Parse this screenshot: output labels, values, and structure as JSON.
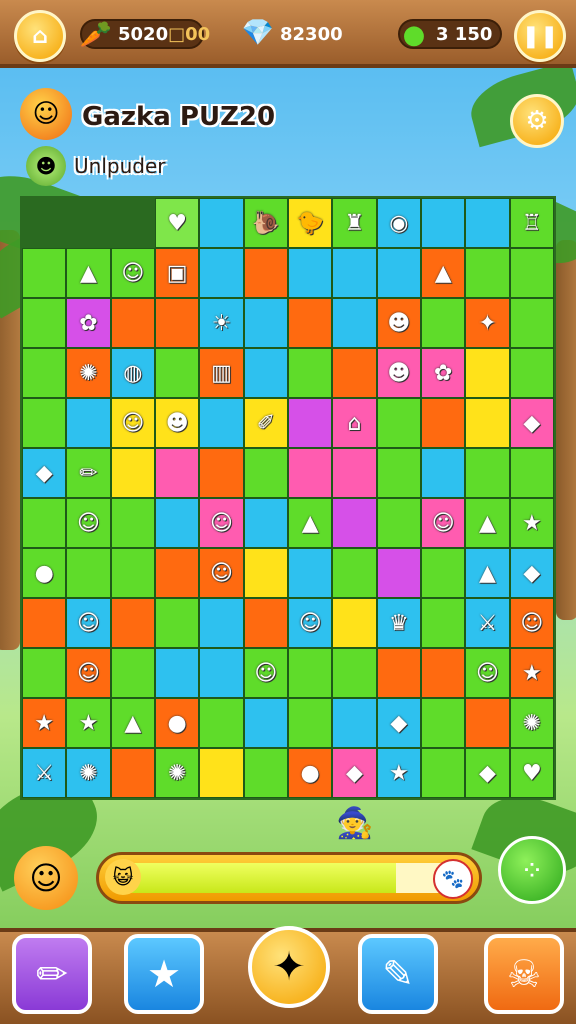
{
  "top_bar": {
    "home_icon": "house-icon",
    "coins_value": "5020",
    "coins_suffix": "□00",
    "coins_icon": "carrot-icon",
    "gems_value": "82300",
    "gems_icon": "crystal-icon",
    "lives_value": "3 150",
    "lives_icon": "green-orb-icon",
    "pause_icon": "pause-icon"
  },
  "header": {
    "title": "Gazka PUZ20",
    "subtitle": "Unlpuder",
    "title_icon": "sun-mascot-icon",
    "settings_icon": "gear-icon"
  },
  "grid": {
    "rows": [
      [
        "",
        "",
        "",
        "lg",
        "b",
        "g",
        "y",
        "g",
        "b",
        "b",
        "b",
        "g"
      ],
      [
        "g",
        "g",
        "g",
        "o",
        "b",
        "o",
        "b",
        "b",
        "b",
        "o",
        "g",
        "g"
      ],
      [
        "g",
        "p",
        "o",
        "o",
        "b",
        "b",
        "o",
        "b",
        "o",
        "g",
        "o",
        "g"
      ],
      [
        "g",
        "o",
        "b",
        "g",
        "o",
        "b",
        "g",
        "o",
        "pk",
        "pk",
        "y",
        "g"
      ],
      [
        "g",
        "b",
        "y",
        "y",
        "b",
        "y",
        "p",
        "pk",
        "g",
        "o",
        "y",
        "pk"
      ],
      [
        "b",
        "g",
        "y",
        "pk",
        "o",
        "g",
        "pk",
        "pk",
        "g",
        "b",
        "g",
        "g"
      ],
      [
        "g",
        "g",
        "g",
        "b",
        "pk",
        "b",
        "g",
        "p",
        "g",
        "pk",
        "g",
        "g"
      ],
      [
        "g",
        "g",
        "g",
        "o",
        "o",
        "y",
        "b",
        "g",
        "p",
        "g",
        "b",
        "b"
      ],
      [
        "o",
        "b",
        "o",
        "g",
        "b",
        "o",
        "b",
        "y",
        "b",
        "g",
        "b",
        "o"
      ],
      [
        "g",
        "o",
        "g",
        "b",
        "b",
        "g",
        "g",
        "g",
        "o",
        "o",
        "g",
        "o"
      ],
      [
        "o",
        "g",
        "g",
        "o",
        "g",
        "b",
        "g",
        "b",
        "b",
        "g",
        "o",
        "g"
      ],
      [
        "b",
        "b",
        "o",
        "g",
        "y",
        "g",
        "o",
        "pk",
        "b",
        "g",
        "g",
        "g"
      ]
    ],
    "pieces": [
      [
        "",
        "",
        "",
        "heart",
        "",
        "snail",
        "chick",
        "tower",
        "candy",
        "",
        "",
        "castle"
      ],
      [
        "",
        "cone",
        "gnome",
        "basket",
        "",
        "",
        "",
        "",
        "",
        "cone2",
        "",
        ""
      ],
      [
        "",
        "fairy",
        "",
        "",
        "sun",
        "",
        "",
        "",
        "frog",
        "",
        "spark",
        ""
      ],
      [
        "",
        "crab",
        "shell",
        "",
        "drum",
        "",
        "",
        "",
        "bear",
        "flower",
        "",
        ""
      ],
      [
        "",
        "",
        "bunny",
        "fox",
        "",
        "brush",
        "",
        "chair",
        "",
        "",
        "",
        "bell"
      ],
      [
        "dino",
        "pencil",
        "",
        "",
        "",
        "",
        "",
        "",
        "",
        "",
        "",
        ""
      ],
      [
        "",
        "gnome2",
        "",
        "",
        "jelly",
        "",
        "cone3",
        "",
        "",
        "squid",
        "hat",
        "star"
      ],
      [
        "fox2",
        "",
        "",
        "",
        "fish",
        "",
        "",
        "",
        "",
        "",
        "rocket",
        "whale"
      ],
      [
        "",
        "kid",
        "",
        "",
        "",
        "",
        "kid2",
        "",
        "viking",
        "",
        "swords",
        "elf"
      ],
      [
        "",
        "kid3",
        "",
        "",
        "",
        "gnome4",
        "",
        "",
        "",
        "",
        "kid4",
        "star2"
      ],
      [
        "star3",
        "star4",
        "jar",
        "pot",
        "",
        "",
        "",
        "",
        "frog2",
        "",
        "",
        "bug"
      ],
      [
        "sword",
        "lizard",
        "",
        "rattle",
        "",
        "",
        "bird",
        "seahorse",
        "star5",
        "",
        "ghost",
        "heart2"
      ]
    ]
  },
  "bottom_bar": {
    "progress_percent": 80,
    "progress_left_icon": "cat-face-icon",
    "progress_right_icon": "paw-icon",
    "side_button_icon": "green-dots-icon",
    "tools": [
      "pencil-icon",
      "star-face-icon",
      "ghost-star-icon",
      "wand-icon",
      "bone-skull-icon"
    ]
  },
  "colors": {
    "g": "#5fdc2a",
    "b": "#2ec1ef",
    "o": "#ff6a10",
    "y": "#ffe21a",
    "p": "#d650e8",
    "pk": "#ff5cb0",
    "lg": "#7fe64a"
  }
}
